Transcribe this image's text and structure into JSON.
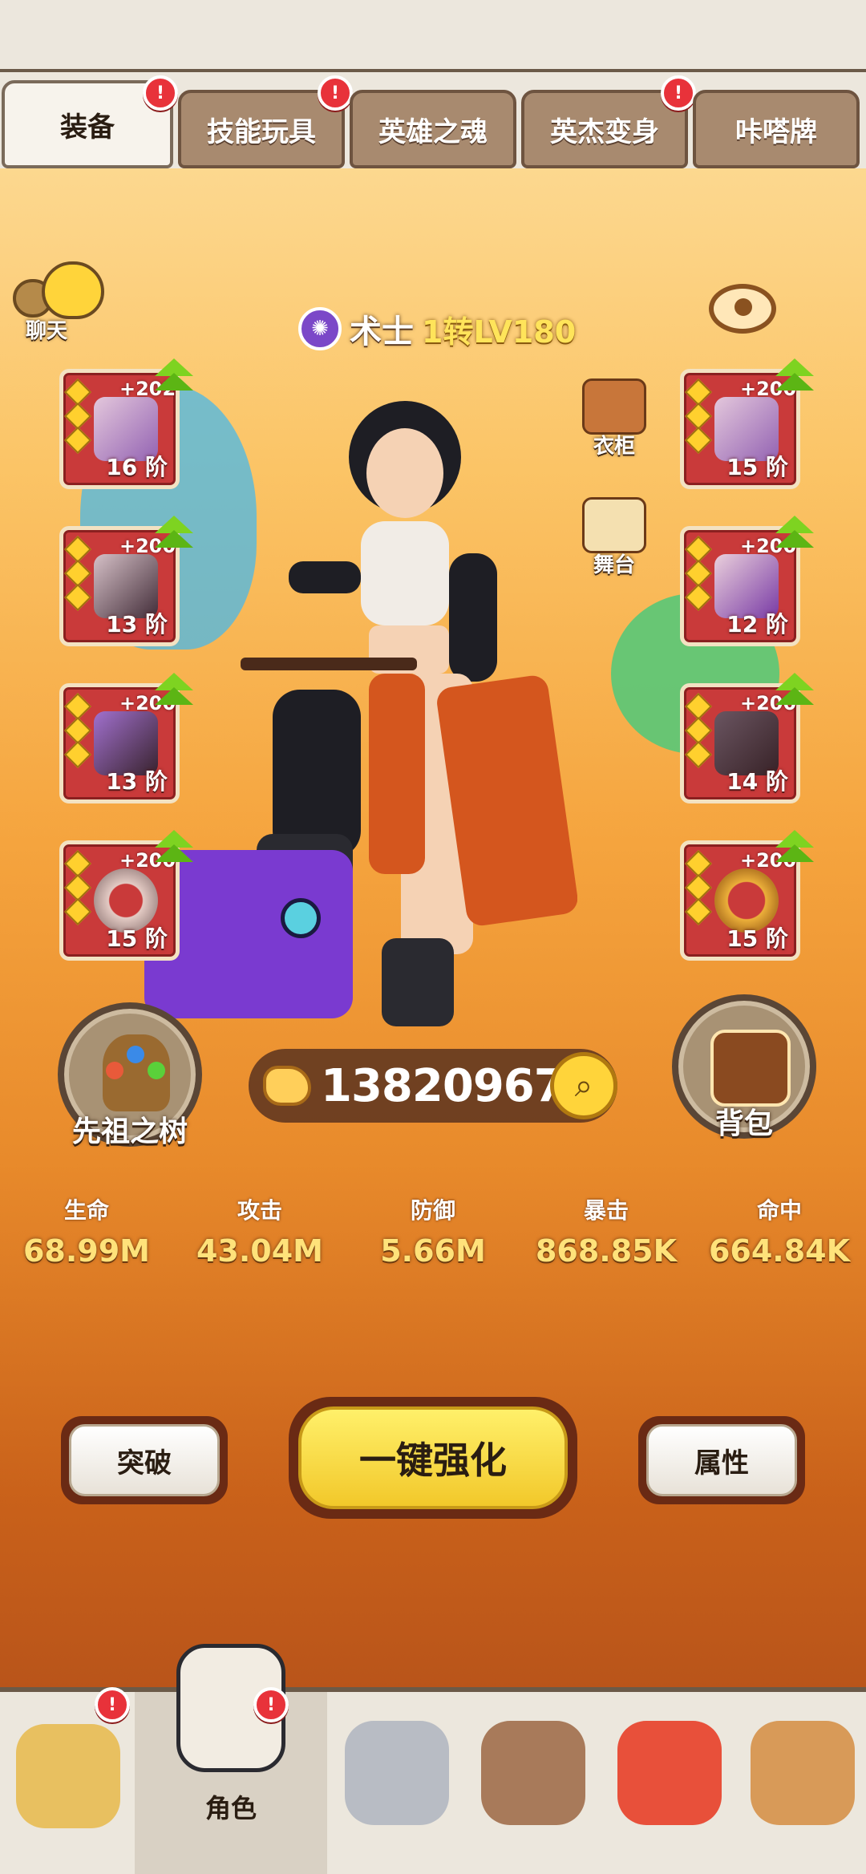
{
  "tabs": [
    {
      "label": "装备",
      "active": true,
      "badge": true
    },
    {
      "label": "技能玩具",
      "active": false,
      "badge": true
    },
    {
      "label": "英雄之魂",
      "active": false,
      "badge": false
    },
    {
      "label": "英杰变身",
      "active": false,
      "badge": true
    },
    {
      "label": "咔嗒牌",
      "active": false,
      "badge": false
    }
  ],
  "chat": {
    "label": "聊天"
  },
  "hero": {
    "class_name": "术士",
    "level": "1转LV180"
  },
  "left_slots": [
    {
      "plus": "+202",
      "tier": "16 阶"
    },
    {
      "plus": "+200",
      "tier": "13 阶"
    },
    {
      "plus": "+200",
      "tier": "13 阶"
    },
    {
      "plus": "+200",
      "tier": "15 阶"
    }
  ],
  "right_slots": [
    {
      "plus": "+200",
      "tier": "15 阶"
    },
    {
      "plus": "+200",
      "tier": "12 阶"
    },
    {
      "plus": "+200",
      "tier": "14 阶"
    },
    {
      "plus": "+200",
      "tier": "15 阶"
    }
  ],
  "wardrobe": {
    "label": "衣柜"
  },
  "stage": {
    "label": "舞台"
  },
  "ancestor_tree": {
    "label": "先祖之树"
  },
  "backpack": {
    "label": "背包"
  },
  "power": {
    "value": "138209672"
  },
  "stats": [
    {
      "label": "生命",
      "value": "68.99M"
    },
    {
      "label": "攻击",
      "value": "43.04M"
    },
    {
      "label": "防御",
      "value": "5.66M"
    },
    {
      "label": "暴击",
      "value": "868.85K"
    },
    {
      "label": "命中",
      "value": "664.84K"
    }
  ],
  "actions": {
    "breakthrough": "突破",
    "enhance_all": "一键强化",
    "attributes": "属性"
  },
  "bottom_nav": [
    {
      "label": "",
      "icon": "straw-hero-icon",
      "badge": true
    },
    {
      "label": "角色",
      "icon": "skull-hero-icon",
      "badge": true,
      "active": true
    },
    {
      "label": "",
      "icon": "sword-shield-icon",
      "badge": false
    },
    {
      "label": "",
      "icon": "elder-icon",
      "badge": false
    },
    {
      "label": "",
      "icon": "red-dino-icon",
      "badge": false
    },
    {
      "label": "",
      "icon": "tiki-icon",
      "badge": false
    }
  ],
  "colors": {
    "accent_gold": "#ffe27a",
    "badge_red": "#e8323a",
    "upgrade_green": "#7ed321",
    "slot_red": "#c93a3a"
  }
}
